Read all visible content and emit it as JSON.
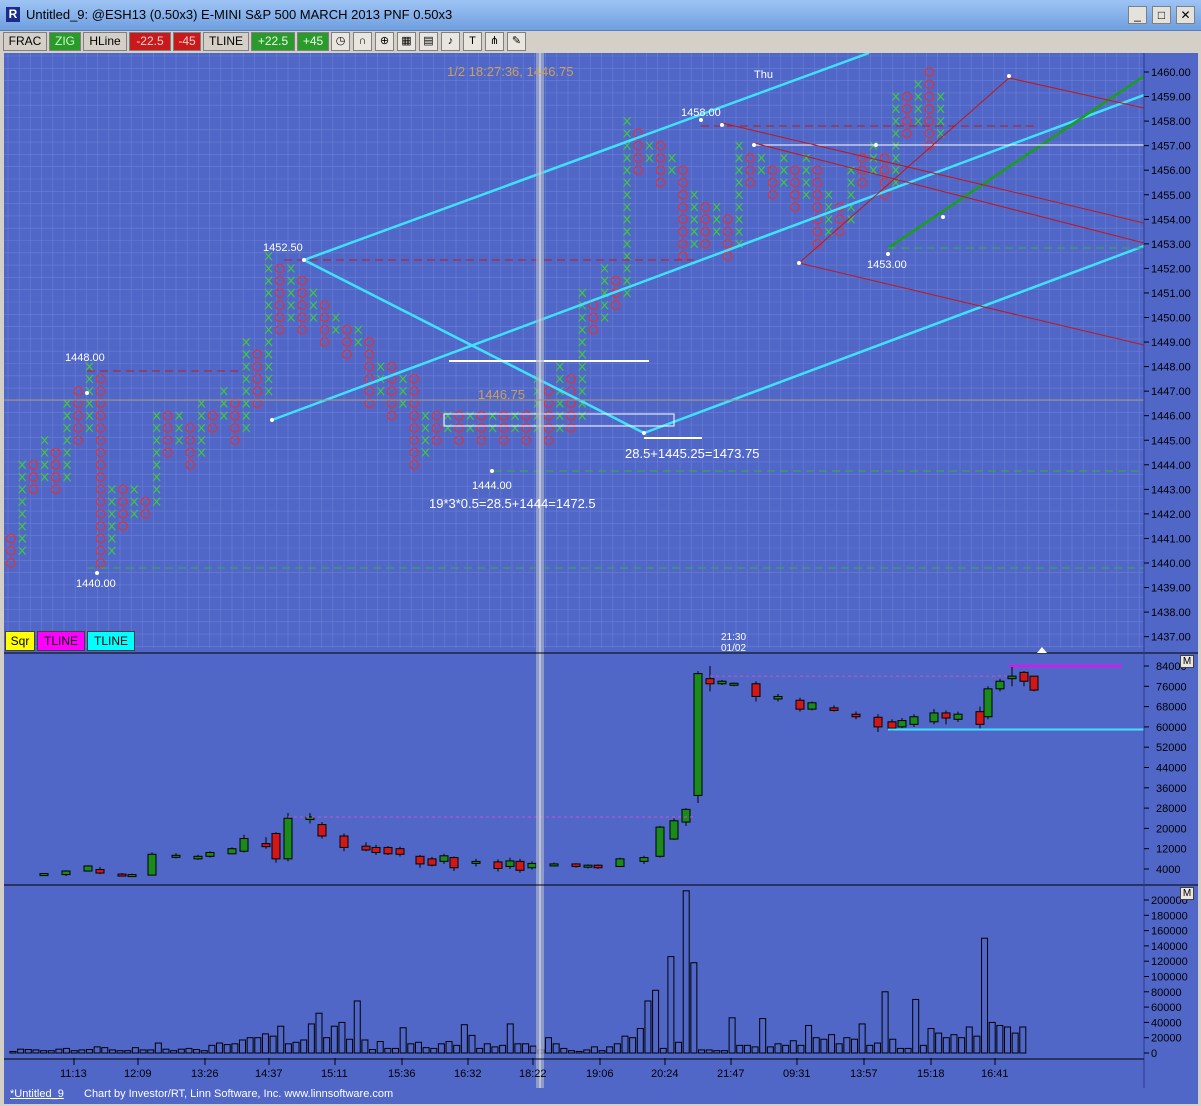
{
  "window": {
    "title": "Untitled_9: @ESH13 (0.50x3) E-MINI S&P 500 MARCH 2013 PNF 0.50x3",
    "icon": "R",
    "minimize": "_",
    "maximize": "□",
    "close": "✕"
  },
  "toolbar": {
    "buttons": [
      {
        "label": "FRAC",
        "bg": "#d4d0c8",
        "color": "#000000"
      },
      {
        "label": "ZIG",
        "bg": "#2a9a2a",
        "color": "#c8ffc8"
      },
      {
        "label": "HLine",
        "bg": "#d4d0c8",
        "color": "#000000"
      },
      {
        "label": "-22.5",
        "bg": "#c81a1a",
        "color": "#ffd0d0"
      },
      {
        "label": "-45",
        "bg": "#c81a1a",
        "color": "#ffd0d0"
      },
      {
        "label": "TLINE",
        "bg": "#d4d0c8",
        "color": "#000000"
      },
      {
        "label": "+22.5",
        "bg": "#2a9a2a",
        "color": "#e8ffe8"
      },
      {
        "label": "+45",
        "bg": "#2a9a2a",
        "color": "#e8ffe8"
      }
    ],
    "icons": [
      "clock-icon",
      "magnet-icon",
      "zoom-icon",
      "grid-icon",
      "chart-icon",
      "bell-icon",
      "text-icon",
      "fork-icon",
      "draw-icon"
    ]
  },
  "price_panel": {
    "axis_labels": [
      "1460.00",
      "1459.00",
      "1458.00",
      "1457.00",
      "1456.00",
      "1455.00",
      "1454.00",
      "1453.00",
      "1452.00",
      "1451.00",
      "1450.00",
      "1449.00",
      "1448.00",
      "1447.00",
      "1446.00",
      "1445.00",
      "1444.00",
      "1443.00",
      "1442.00",
      "1441.00",
      "1440.00",
      "1439.00",
      "1438.00",
      "1437.00"
    ],
    "cursor_label": "1/2 18:27:36, 1446.75",
    "day_label": "Thu",
    "crosshair_price": "1446.75",
    "annotations": [
      {
        "text": "1452.50"
      },
      {
        "text": "1448.00"
      },
      {
        "text": "1440.00"
      },
      {
        "text": "1444.00"
      },
      {
        "text": "1458.00"
      },
      {
        "text": "1453.00"
      },
      {
        "text": "28.5+1445.25=1473.75"
      },
      {
        "text": "19*3*0.5=28.5+1444=1472.5"
      }
    ],
    "bottom_buttons": [
      {
        "label": "Sqr",
        "bg": "#ffff00"
      },
      {
        "label": "TLINE",
        "bg": "#ff00ff"
      },
      {
        "label": "TLINE",
        "bg": "#00ffff"
      }
    ],
    "time_marker": [
      "21:30",
      "01/02"
    ]
  },
  "candle_panel": {
    "axis_labels": [
      "84000",
      "76000",
      "68000",
      "60000",
      "52000",
      "44000",
      "36000",
      "28000",
      "20000",
      "12000",
      "4000"
    ],
    "m_button": "M"
  },
  "volume_panel": {
    "axis_labels": [
      "200000",
      "180000",
      "160000",
      "140000",
      "120000",
      "100000",
      "80000",
      "60000",
      "40000",
      "20000",
      "0"
    ],
    "m_button": "M"
  },
  "time_axis": [
    "11:13",
    "12:09",
    "13:26",
    "14:37",
    "15:11",
    "15:36",
    "16:32",
    "18:22",
    "19:06",
    "20:24",
    "21:47",
    "09:31",
    "13:57",
    "15:18",
    "16:41"
  ],
  "statusbar": {
    "tab": "*Untitled_9",
    "credit": "Chart by Investor/RT, Linn Software, Inc. www.linnsoftware.com"
  },
  "colors": {
    "chart_bg": "#5067c8",
    "grid": "#6a7fd4",
    "x_mark": "#3ec83e",
    "o_mark": "#e83030",
    "trend_cyan": "#40e0ff",
    "trend_red": "#c01818",
    "trend_green": "#18a018"
  }
}
